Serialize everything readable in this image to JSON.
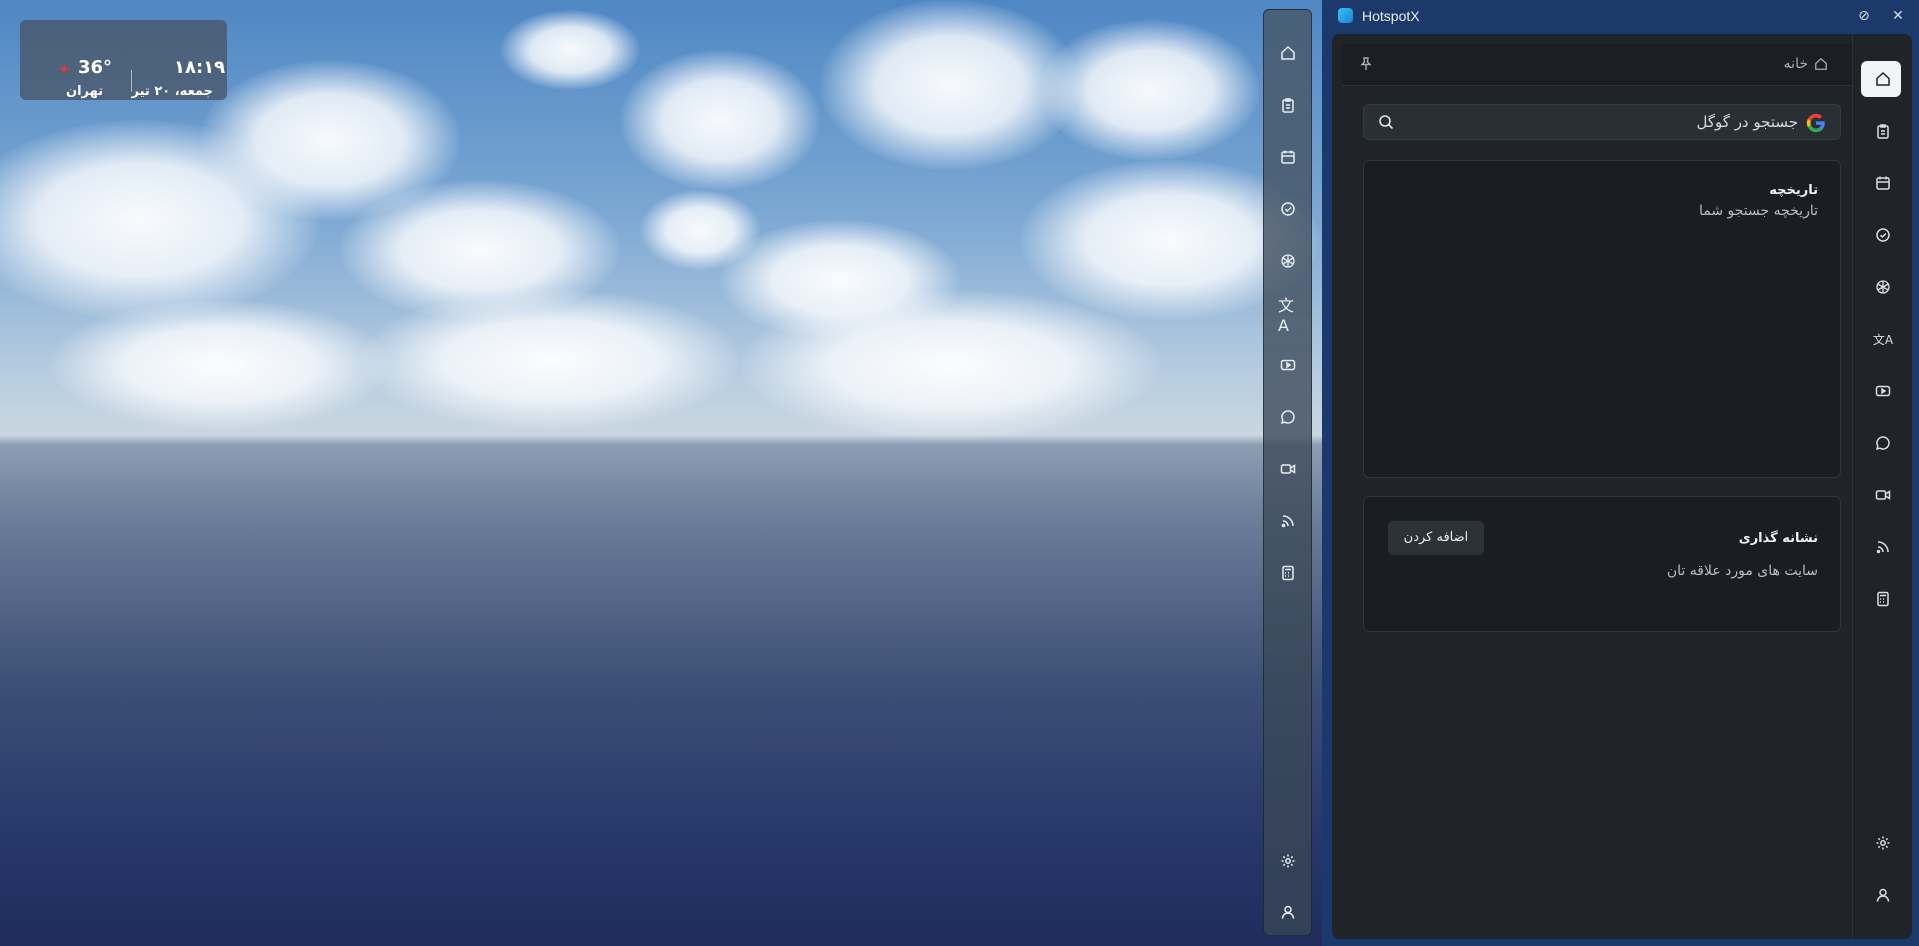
{
  "desktop": {
    "weather": {
      "time": "۱۸:۱۹",
      "date": "جمعه، ۲۰ تیر",
      "temperature": "36°",
      "city": "تهران"
    },
    "dock_icons": [
      "home-icon",
      "clipboard-icon",
      "calendar-icon",
      "check-circle-icon",
      "openai-icon",
      "translate-icon",
      "youtube-icon",
      "chat-icon",
      "video-icon",
      "rss-icon",
      "calculator-icon",
      "gear-icon",
      "user-icon"
    ]
  },
  "app": {
    "title": "HotspotX",
    "breadcrumb": "خانه",
    "search": {
      "placeholder": "جستجو در گوگل"
    },
    "history": {
      "title": "تاریخچه",
      "subtitle": "تاریخچه جستجو شما"
    },
    "bookmarks": {
      "title": "نشانه گذاری",
      "subtitle": "سایت های مورد علاقه تان",
      "add_label": "اضافه کردن"
    },
    "rail_icons": [
      "home-icon",
      "clipboard-icon",
      "calendar-icon",
      "check-circle-icon",
      "openai-icon",
      "translate-icon",
      "youtube-icon",
      "chat-icon",
      "video-icon",
      "rss-icon",
      "calculator-icon",
      "gear-icon",
      "user-icon"
    ]
  }
}
